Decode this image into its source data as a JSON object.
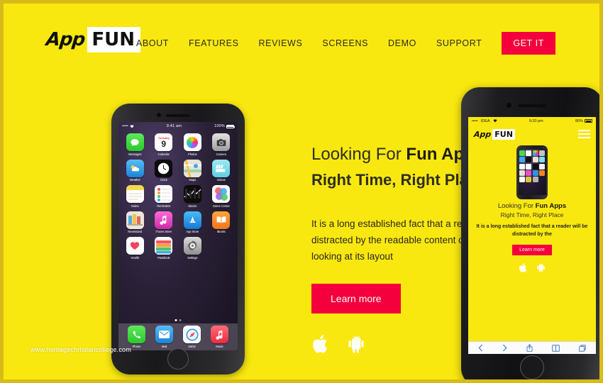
{
  "brand": {
    "logo_app": "App",
    "logo_fun": "FUN",
    "accent_red": "#f4003c",
    "background_yellow": "#f9e80f"
  },
  "header": {
    "nav": [
      {
        "label": "ABOUT"
      },
      {
        "label": "FEATURES"
      },
      {
        "label": "REVIEWS"
      },
      {
        "label": "SCREENS"
      },
      {
        "label": "DEMO"
      },
      {
        "label": "SUPPORT"
      }
    ],
    "cta_label": "GET IT"
  },
  "hero": {
    "title_prefix": "Looking For ",
    "title_strong": "Fun Apps",
    "subtitle": "Right Time, Right Place",
    "body": "It is a long established fact that a reader will be distracted by the readable content of a page when looking at its layout",
    "button_label": "Learn more",
    "store_icons": [
      "apple-icon",
      "android-icon"
    ]
  },
  "phone_left": {
    "status": {
      "carrier_dots": "•••••",
      "wifi": "wifi-icon",
      "time": "9:41 am",
      "battery_percent": "100%"
    },
    "apps": [
      {
        "label": "Messages",
        "glyph": "",
        "bg": "linear-gradient(#5ee85c,#2bc92b)"
      },
      {
        "label": "Calendar",
        "glyph": "9",
        "bg": "#ffffff"
      },
      {
        "label": "Photos",
        "glyph": "",
        "bg": "#ffffff"
      },
      {
        "label": "Camera",
        "glyph": "",
        "bg": "linear-gradient(#d8d8d8,#9a9a9a)"
      },
      {
        "label": "Weather",
        "glyph": "",
        "bg": "linear-gradient(#4fb8f5,#1b82d6)"
      },
      {
        "label": "Clock",
        "glyph": "",
        "bg": "#0c0c0c"
      },
      {
        "label": "Maps",
        "glyph": "",
        "bg": "#f0efe8"
      },
      {
        "label": "Videos",
        "glyph": "",
        "bg": "linear-gradient(#8fe6f0,#63d4e6)"
      },
      {
        "label": "Notes",
        "glyph": "",
        "bg": "#ffffff"
      },
      {
        "label": "Reminders",
        "glyph": "",
        "bg": "#ffffff"
      },
      {
        "label": "Stocks",
        "glyph": "",
        "bg": "#0b0b0b"
      },
      {
        "label": "Game Center",
        "glyph": "",
        "bg": "#ffffff"
      },
      {
        "label": "Newsstand",
        "glyph": "",
        "bg": "#e9e6dc"
      },
      {
        "label": "iTunes Store",
        "glyph": "",
        "bg": "linear-gradient(#ff6ad8,#d62ab0)"
      },
      {
        "label": "App Store",
        "glyph": "",
        "bg": "linear-gradient(#3db7f0,#1876d6)"
      },
      {
        "label": "iBooks",
        "glyph": "",
        "bg": "linear-gradient(#ff9a2e,#f3741b)"
      },
      {
        "label": "Health",
        "glyph": "",
        "bg": "#ffffff"
      },
      {
        "label": "Passbook",
        "glyph": "",
        "bg": "#ffffff"
      },
      {
        "label": "Settings",
        "glyph": "",
        "bg": "linear-gradient(#d6d6d6,#8e8e8e)"
      }
    ],
    "dock": [
      {
        "label": "Phone",
        "bg": "linear-gradient(#5ee85c,#2bc92b)"
      },
      {
        "label": "Mail",
        "bg": "linear-gradient(#4fb8f5,#1b82d6)"
      },
      {
        "label": "Safari",
        "bg": "#ffffff"
      },
      {
        "label": "Music",
        "bg": "linear-gradient(#ff5f6d,#f0293f)"
      }
    ]
  },
  "phone_right": {
    "status": {
      "carrier_dots": "•••••",
      "carrier": "IDEA",
      "wifi": "wifi-icon",
      "time": "9:20 pm",
      "battery_percent": "80%"
    },
    "logo_app": "App",
    "logo_fun": "FUN",
    "menu_icon": "hamburger-icon",
    "title_prefix": "Looking For ",
    "title_strong": "Fun Apps",
    "subtitle": "Right Time, Right Place",
    "body": "It is a long established fact that a reader will be distracted by the",
    "button_label": "Learn more",
    "store_icons": [
      "apple-icon",
      "android-icon"
    ],
    "browser_toolbar": [
      "back-icon",
      "forward-icon",
      "share-icon",
      "bookmarks-icon",
      "tabs-icon"
    ]
  },
  "watermark": "www.heritagechristiancollege.com"
}
